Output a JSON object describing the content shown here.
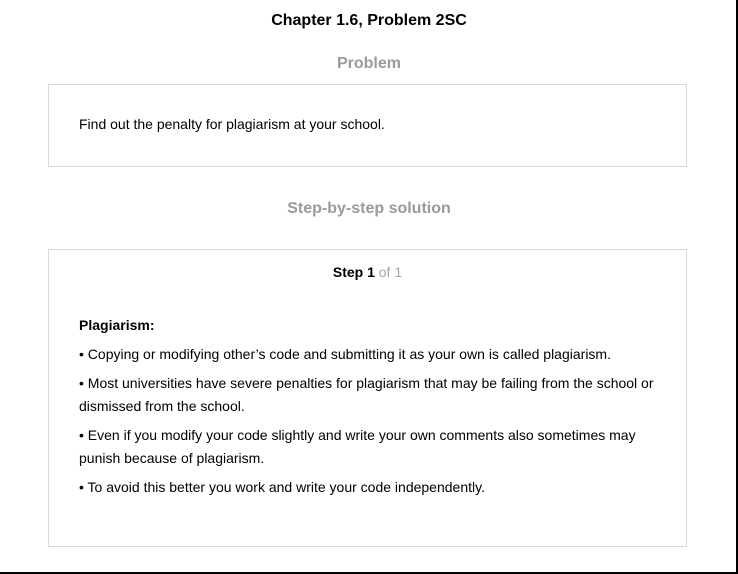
{
  "page": {
    "title": "Chapter 1.6, Problem 2SC"
  },
  "problem": {
    "heading": "Problem",
    "text": "Find out the penalty for plagiarism at your school."
  },
  "solution": {
    "heading": "Step-by-step solution",
    "step_label": "Step 1",
    "step_of": " of 1",
    "term": "Plagiarism:",
    "bullets": [
      "• Copying or modifying other’s code and submitting it as your own is called plagiarism.",
      "• Most universities have severe penalties for plagiarism that may be failing from the school or dismissed from the school.",
      "• Even if you modify your code slightly and write your own comments also sometimes may punish because of plagiarism.",
      "• To avoid this better you work and write your code independently."
    ]
  },
  "colors": {
    "heading_gray": "#9a9a9a",
    "border": "#d9d9d9",
    "step_of_gray": "#a6a6a6"
  }
}
